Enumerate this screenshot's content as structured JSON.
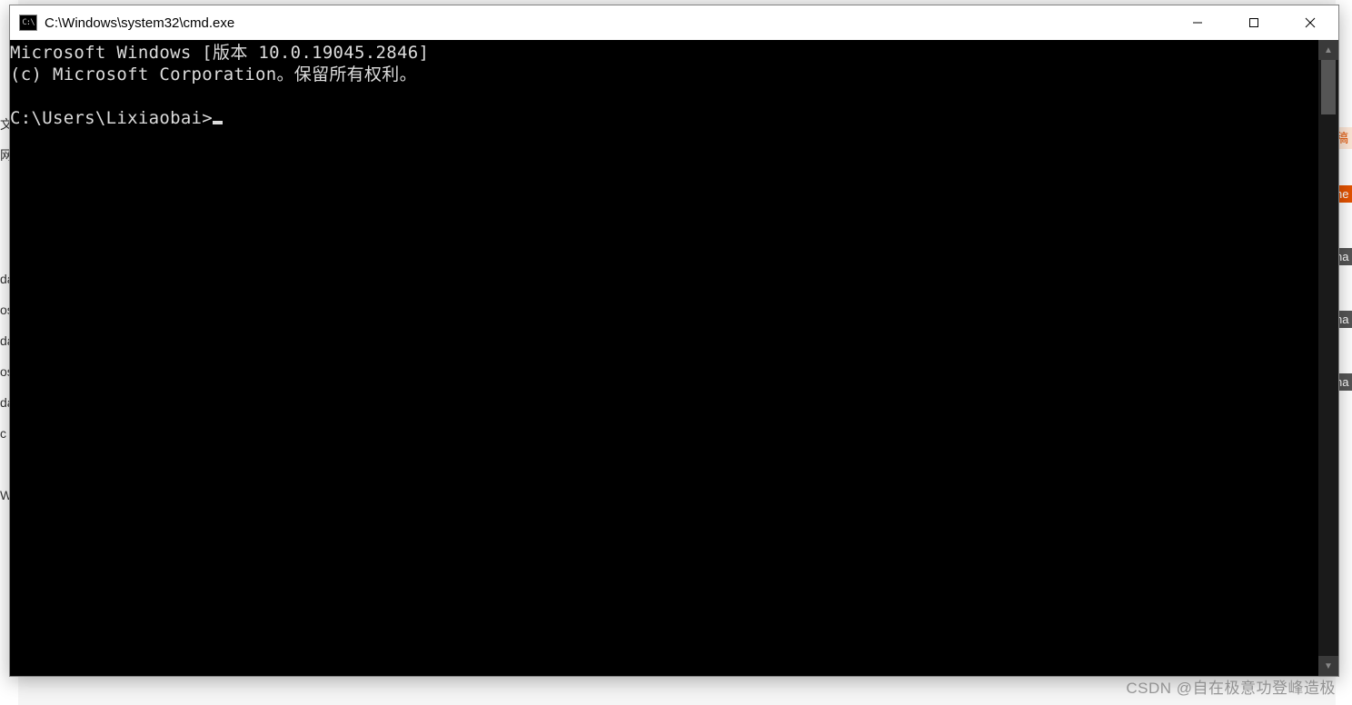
{
  "window": {
    "title": "C:\\Windows\\system32\\cmd.exe",
    "icon_label": "C:\\"
  },
  "console": {
    "line1": "Microsoft Windows [版本 10.0.19045.2846]",
    "line2": "(c) Microsoft Corporation。保留所有权利。",
    "blank": "",
    "prompt": "C:\\Users\\Lixiaobai>"
  },
  "background": {
    "left_fragments": [
      "文",
      "网",
      "da",
      "os",
      "da",
      "os",
      "da",
      "c",
      "W"
    ],
    "right_frag_a": "稿",
    "right_frag_b": "ne",
    "right_frag_c": "na"
  },
  "watermark": "CSDN @自在极意功登峰造极"
}
